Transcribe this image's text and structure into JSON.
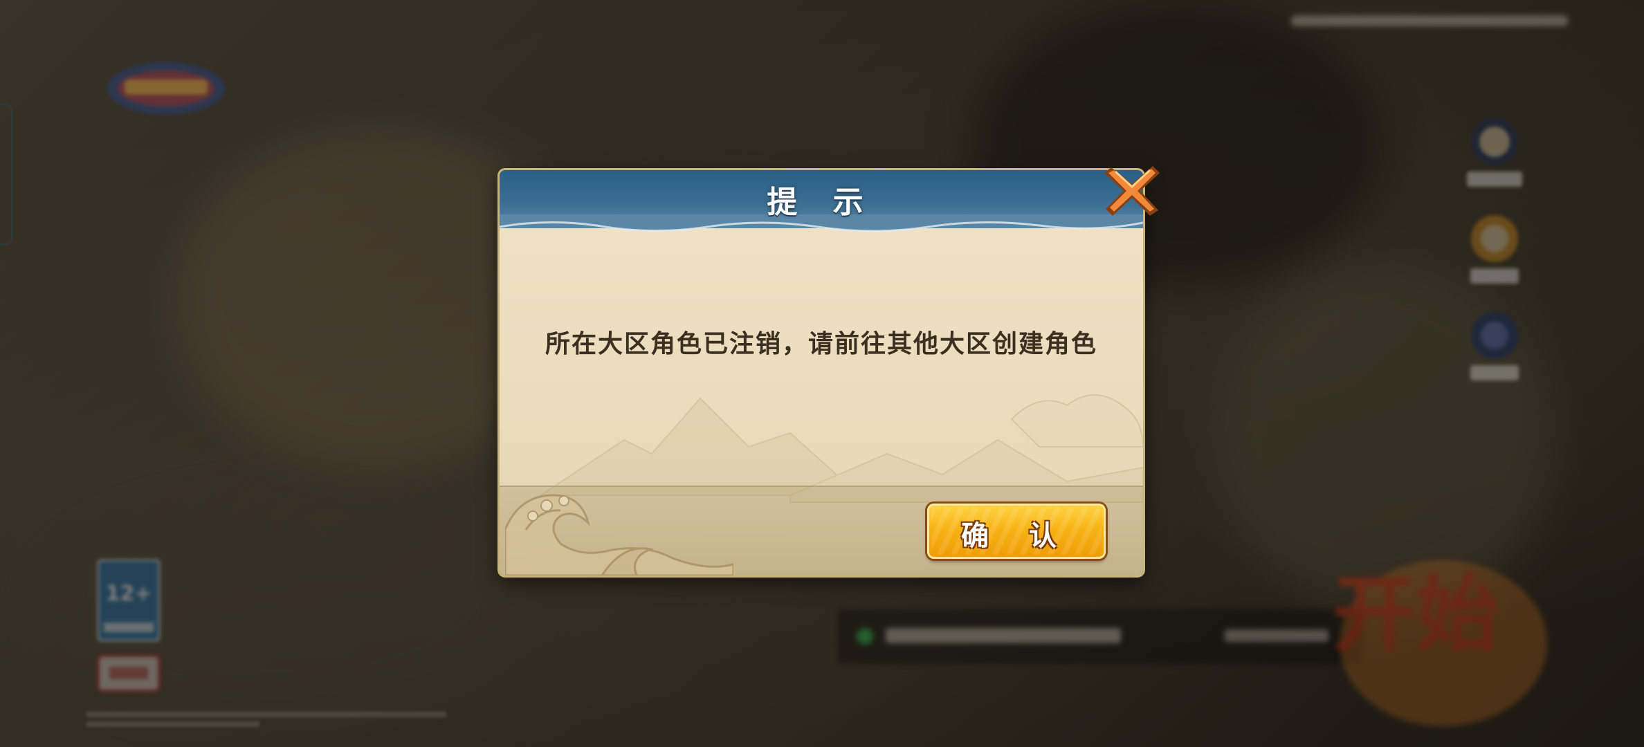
{
  "dialog": {
    "title": "提 示",
    "message": "所在大区角色已注销，请前往其他大区创建角色",
    "confirm_label": "确 认"
  },
  "background": {
    "age_rating": "12+",
    "start_art_text": "开始"
  },
  "colors": {
    "header_blue": "#2b5f86",
    "parchment": "#efe3c6",
    "button_gold": "#f7b415",
    "close_orange": "#f08a3a"
  },
  "icons": {
    "close": "close-x-icon"
  }
}
